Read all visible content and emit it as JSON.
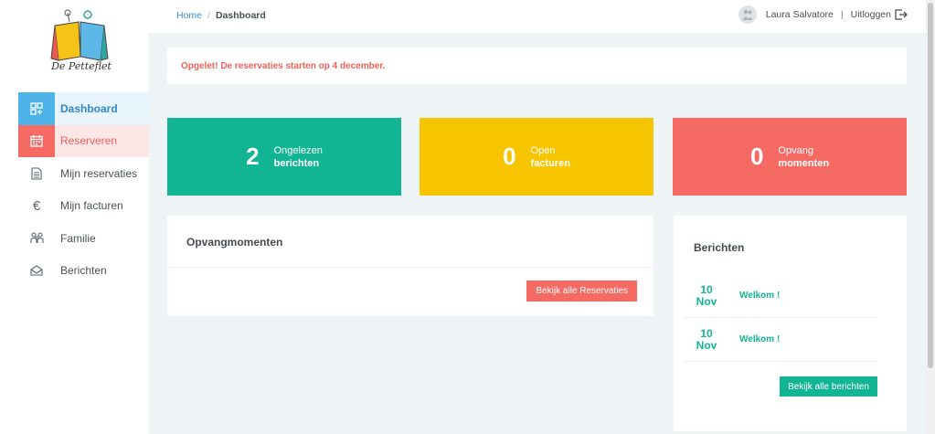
{
  "brand": {
    "name": "De Petteflet"
  },
  "sidebar": {
    "items": [
      {
        "label": "Dashboard",
        "icon": "dashboard-icon"
      },
      {
        "label": "Reserveren",
        "icon": "calendar-icon"
      },
      {
        "label": "Mijn reservaties",
        "icon": "document-icon"
      },
      {
        "label": "Mijn facturen",
        "icon": "euro-icon"
      },
      {
        "label": "Familie",
        "icon": "family-icon"
      },
      {
        "label": "Berichten",
        "icon": "envelope-icon"
      }
    ]
  },
  "header": {
    "breadcrumb": {
      "home": "Home",
      "separator": "/",
      "current": "Dashboard"
    },
    "user_name": "Laura Salvatore",
    "separator": "|",
    "logout_label": "Uitloggen"
  },
  "alert": {
    "text": "Opgelet! De reservaties starten op 4 december."
  },
  "stats": [
    {
      "value": "2",
      "line1": "Ongelezen",
      "line2": "berichten",
      "color": "#12b593"
    },
    {
      "value": "0",
      "line1": "Open",
      "line2": "facturen",
      "color": "#f7c400"
    },
    {
      "value": "0",
      "line1": "Opvang",
      "line2": "momenten",
      "color": "#f56a62"
    }
  ],
  "opvang": {
    "title": "Opvangmomenten",
    "button": "Bekijk alle Reservaties"
  },
  "berichten": {
    "title": "Berichten",
    "items": [
      {
        "day": "10",
        "month": "Nov",
        "title": "Welkom !"
      },
      {
        "day": "10",
        "month": "Nov",
        "title": "Welkom !"
      }
    ],
    "button": "Bekijk alle berichten"
  },
  "colors": {
    "accent_blue": "#4db3e9",
    "accent_red": "#f56a62",
    "accent_green": "#12b593",
    "accent_yellow": "#f7c400"
  }
}
